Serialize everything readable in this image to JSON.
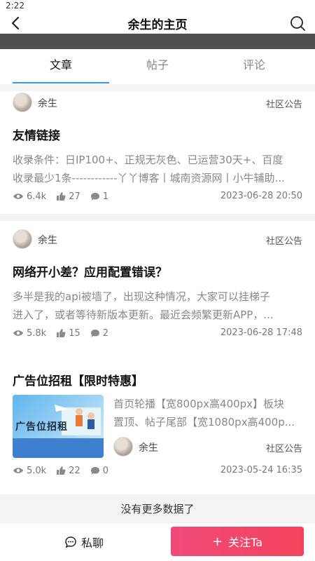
{
  "status_bar": {
    "time": "2:22"
  },
  "header": {
    "title": "余生的主页",
    "back_icon": "chevron-left-icon",
    "search_icon": "search-icon"
  },
  "tabs": [
    {
      "label": "文章",
      "active": true
    },
    {
      "label": "帖子",
      "active": false
    },
    {
      "label": "评论",
      "active": false
    }
  ],
  "posts": [
    {
      "author": "余生",
      "category": "社区公告",
      "title": "友情链接",
      "summary_lines": [
        "收录条件：日IP100+、正规无灰色、已运营30天+、百度",
        "收录最少1条------------丫丫博客丨城南资源网丨小牛辅助..."
      ],
      "views": "6.4k",
      "likes": "27",
      "comments": "1",
      "date": "2023-06-28 20:50"
    },
    {
      "author": "余生",
      "category": "社区公告",
      "title": "网络开小差？应用配置错误？",
      "summary_lines": [
        "多半是我的api被墙了，出现这种情况，大家可以挂梯子",
        "进入了，或者等待新版本更新。最近会频繁更新APP，..."
      ],
      "views": "5.8k",
      "likes": "15",
      "comments": "2",
      "date": "2023-06-28 17:48"
    },
    {
      "author": "余生",
      "category": "社区公告",
      "title": "广告位招租【限时特惠】",
      "image_caption": "广告位招租",
      "summary_lines": [
        "首页轮播【宽800px高400px】板块",
        "置顶、帖子尾部【宽1080px高400p..."
      ],
      "views": "5.0k",
      "likes": "22",
      "comments": "0",
      "date": "2023-05-24 16:35"
    }
  ],
  "footer_note": "没有更多数据了",
  "actions": {
    "chat_label": "私聊",
    "follow_label": "关注Ta",
    "follow_plus": "+"
  },
  "colors": {
    "accent_blue": "#2a9df4",
    "follow_pink": "#f3435c"
  }
}
